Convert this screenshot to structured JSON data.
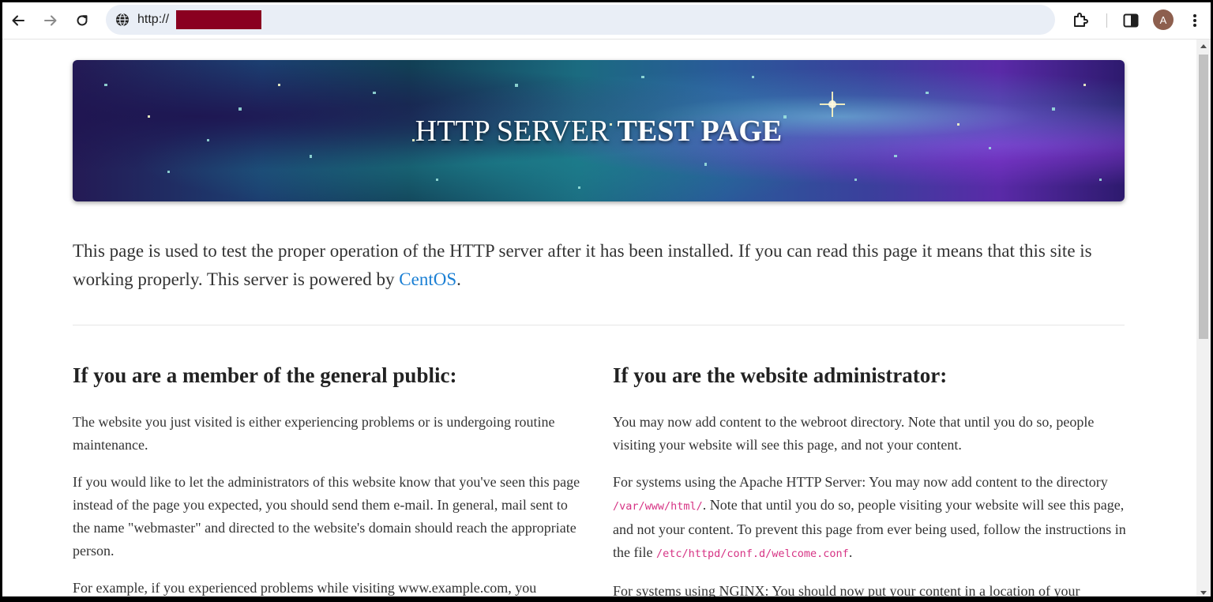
{
  "browser": {
    "url_prefix": "http://",
    "profile_initial": "A"
  },
  "banner": {
    "title_regular": "HTTP SERVER",
    "title_bold": "TEST PAGE"
  },
  "intro": {
    "text_before_link": "This page is used to test the proper operation of the HTTP server after it has been installed. If you can read this page it means that this site is working properly. This server is powered by ",
    "link_text": "CentOS",
    "text_after_link": "."
  },
  "public": {
    "heading": "If you are a member of the general public:",
    "p1": "The website you just visited is either experiencing problems or is undergoing routine maintenance.",
    "p2": "If you would like to let the administrators of this website know that you've seen this page instead of the page you expected, you should send them e-mail. In general, mail sent to the name \"webmaster\" and directed to the website's domain should reach the appropriate person.",
    "p3": "For example, if you experienced problems while visiting www.example.com, you"
  },
  "admin": {
    "heading": "If you are the website administrator:",
    "p1": "You may now add content to the webroot directory. Note that until you do so, people visiting your website will see this page, and not your content.",
    "p2_a": "For systems using the Apache HTTP Server: You may now add content to the directory ",
    "p2_code1": "/var/www/html/",
    "p2_b": ". Note that until you do so, people visiting your website will see this page, and not your content. To prevent this page from ever being used, follow the instructions in the file ",
    "p2_code2": "/etc/httpd/conf.d/welcome.conf",
    "p2_c": ".",
    "p3": "For systems using NGINX: You should now put your content in a location of your"
  },
  "colors": {
    "link": "#1a7fd4",
    "code": "#d63384",
    "redaction": "#8a0020"
  },
  "icons": [
    "back-arrow-icon",
    "forward-arrow-icon",
    "reload-icon",
    "site-info-icon",
    "extensions-icon",
    "side-panel-icon",
    "kebab-menu-icon"
  ]
}
